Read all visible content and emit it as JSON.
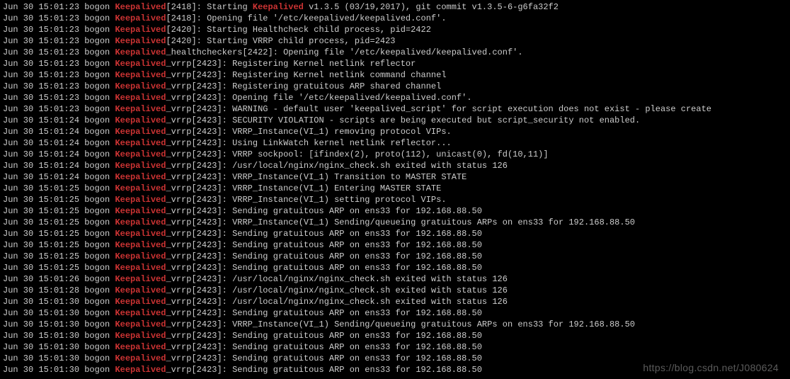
{
  "highlight_word": "Keepalived",
  "log_lines": [
    {
      "ts": "Jun 30 15:01:23",
      "host": "bogon",
      "proc": "Keepalived",
      "pid": "2418",
      "msg": "Starting Keepalived v1.3.5 (03/19,2017), git commit v1.3.5-6-g6fa32f2"
    },
    {
      "ts": "Jun 30 15:01:23",
      "host": "bogon",
      "proc": "Keepalived",
      "pid": "2418",
      "msg": "Opening file '/etc/keepalived/keepalived.conf'."
    },
    {
      "ts": "Jun 30 15:01:23",
      "host": "bogon",
      "proc": "Keepalived",
      "pid": "2420",
      "msg": "Starting Healthcheck child process, pid=2422"
    },
    {
      "ts": "Jun 30 15:01:23",
      "host": "bogon",
      "proc": "Keepalived",
      "pid": "2420",
      "msg": "Starting VRRP child process, pid=2423"
    },
    {
      "ts": "Jun 30 15:01:23",
      "host": "bogon",
      "proc": "Keepalived_healthcheckers",
      "pid": "2422",
      "msg": "Opening file '/etc/keepalived/keepalived.conf'."
    },
    {
      "ts": "Jun 30 15:01:23",
      "host": "bogon",
      "proc": "Keepalived_vrrp",
      "pid": "2423",
      "msg": "Registering Kernel netlink reflector"
    },
    {
      "ts": "Jun 30 15:01:23",
      "host": "bogon",
      "proc": "Keepalived_vrrp",
      "pid": "2423",
      "msg": "Registering Kernel netlink command channel"
    },
    {
      "ts": "Jun 30 15:01:23",
      "host": "bogon",
      "proc": "Keepalived_vrrp",
      "pid": "2423",
      "msg": "Registering gratuitous ARP shared channel"
    },
    {
      "ts": "Jun 30 15:01:23",
      "host": "bogon",
      "proc": "Keepalived_vrrp",
      "pid": "2423",
      "msg": "Opening file '/etc/keepalived/keepalived.conf'."
    },
    {
      "ts": "Jun 30 15:01:23",
      "host": "bogon",
      "proc": "Keepalived_vrrp",
      "pid": "2423",
      "msg": "WARNING - default user 'keepalived_script' for script execution does not exist - please create"
    },
    {
      "ts": "Jun 30 15:01:24",
      "host": "bogon",
      "proc": "Keepalived_vrrp",
      "pid": "2423",
      "msg": "SECURITY VIOLATION - scripts are being executed but script_security not enabled."
    },
    {
      "ts": "Jun 30 15:01:24",
      "host": "bogon",
      "proc": "Keepalived_vrrp",
      "pid": "2423",
      "msg": "VRRP_Instance(VI_1) removing protocol VIPs."
    },
    {
      "ts": "Jun 30 15:01:24",
      "host": "bogon",
      "proc": "Keepalived_vrrp",
      "pid": "2423",
      "msg": "Using LinkWatch kernel netlink reflector..."
    },
    {
      "ts": "Jun 30 15:01:24",
      "host": "bogon",
      "proc": "Keepalived_vrrp",
      "pid": "2423",
      "msg": "VRRP sockpool: [ifindex(2), proto(112), unicast(0), fd(10,11)]"
    },
    {
      "ts": "Jun 30 15:01:24",
      "host": "bogon",
      "proc": "Keepalived_vrrp",
      "pid": "2423",
      "msg": "/usr/local/nginx/nginx_check.sh exited with status 126"
    },
    {
      "ts": "Jun 30 15:01:24",
      "host": "bogon",
      "proc": "Keepalived_vrrp",
      "pid": "2423",
      "msg": "VRRP_Instance(VI_1) Transition to MASTER STATE"
    },
    {
      "ts": "Jun 30 15:01:25",
      "host": "bogon",
      "proc": "Keepalived_vrrp",
      "pid": "2423",
      "msg": "VRRP_Instance(VI_1) Entering MASTER STATE"
    },
    {
      "ts": "Jun 30 15:01:25",
      "host": "bogon",
      "proc": "Keepalived_vrrp",
      "pid": "2423",
      "msg": "VRRP_Instance(VI_1) setting protocol VIPs."
    },
    {
      "ts": "Jun 30 15:01:25",
      "host": "bogon",
      "proc": "Keepalived_vrrp",
      "pid": "2423",
      "msg": "Sending gratuitous ARP on ens33 for 192.168.88.50"
    },
    {
      "ts": "Jun 30 15:01:25",
      "host": "bogon",
      "proc": "Keepalived_vrrp",
      "pid": "2423",
      "msg": "VRRP_Instance(VI_1) Sending/queueing gratuitous ARPs on ens33 for 192.168.88.50"
    },
    {
      "ts": "Jun 30 15:01:25",
      "host": "bogon",
      "proc": "Keepalived_vrrp",
      "pid": "2423",
      "msg": "Sending gratuitous ARP on ens33 for 192.168.88.50"
    },
    {
      "ts": "Jun 30 15:01:25",
      "host": "bogon",
      "proc": "Keepalived_vrrp",
      "pid": "2423",
      "msg": "Sending gratuitous ARP on ens33 for 192.168.88.50"
    },
    {
      "ts": "Jun 30 15:01:25",
      "host": "bogon",
      "proc": "Keepalived_vrrp",
      "pid": "2423",
      "msg": "Sending gratuitous ARP on ens33 for 192.168.88.50"
    },
    {
      "ts": "Jun 30 15:01:25",
      "host": "bogon",
      "proc": "Keepalived_vrrp",
      "pid": "2423",
      "msg": "Sending gratuitous ARP on ens33 for 192.168.88.50"
    },
    {
      "ts": "Jun 30 15:01:26",
      "host": "bogon",
      "proc": "Keepalived_vrrp",
      "pid": "2423",
      "msg": "/usr/local/nginx/nginx_check.sh exited with status 126"
    },
    {
      "ts": "Jun 30 15:01:28",
      "host": "bogon",
      "proc": "Keepalived_vrrp",
      "pid": "2423",
      "msg": "/usr/local/nginx/nginx_check.sh exited with status 126"
    },
    {
      "ts": "Jun 30 15:01:30",
      "host": "bogon",
      "proc": "Keepalived_vrrp",
      "pid": "2423",
      "msg": "/usr/local/nginx/nginx_check.sh exited with status 126"
    },
    {
      "ts": "Jun 30 15:01:30",
      "host": "bogon",
      "proc": "Keepalived_vrrp",
      "pid": "2423",
      "msg": "Sending gratuitous ARP on ens33 for 192.168.88.50"
    },
    {
      "ts": "Jun 30 15:01:30",
      "host": "bogon",
      "proc": "Keepalived_vrrp",
      "pid": "2423",
      "msg": "VRRP_Instance(VI_1) Sending/queueing gratuitous ARPs on ens33 for 192.168.88.50"
    },
    {
      "ts": "Jun 30 15:01:30",
      "host": "bogon",
      "proc": "Keepalived_vrrp",
      "pid": "2423",
      "msg": "Sending gratuitous ARP on ens33 for 192.168.88.50"
    },
    {
      "ts": "Jun 30 15:01:30",
      "host": "bogon",
      "proc": "Keepalived_vrrp",
      "pid": "2423",
      "msg": "Sending gratuitous ARP on ens33 for 192.168.88.50"
    },
    {
      "ts": "Jun 30 15:01:30",
      "host": "bogon",
      "proc": "Keepalived_vrrp",
      "pid": "2423",
      "msg": "Sending gratuitous ARP on ens33 for 192.168.88.50"
    },
    {
      "ts": "Jun 30 15:01:30",
      "host": "bogon",
      "proc": "Keepalived_vrrp",
      "pid": "2423",
      "msg": "Sending gratuitous ARP on ens33 for 192.168.88.50"
    }
  ],
  "watermark": "https://blog.csdn.net/J080624"
}
